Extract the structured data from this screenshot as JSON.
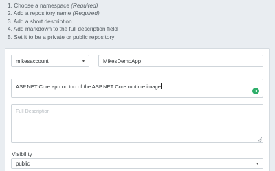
{
  "steps": [
    {
      "text": "1. Choose a namespace ",
      "req": "(Required)"
    },
    {
      "text": "2. Add a repository name ",
      "req": "(Required)"
    },
    {
      "text": "3. Add a short description",
      "req": ""
    },
    {
      "text": "4. Add markdown to the full description field",
      "req": ""
    },
    {
      "text": "5. Set it to be a private or public repository",
      "req": ""
    }
  ],
  "form": {
    "namespace": "mikesaccount",
    "repo_name": "MikesDemoApp",
    "short_description": "ASP.NET Core app on top of the ASP.NET Core runtime image",
    "full_description_placeholder": "Full Description",
    "visibility_label": "Visibility",
    "visibility_value": "public",
    "caret": "▾"
  },
  "colors": {
    "background": "#e9edf1",
    "status_green": "#2eae6a"
  },
  "icons": {
    "status": "loading-check-icon",
    "dropdown": "chevron-down-icon"
  }
}
